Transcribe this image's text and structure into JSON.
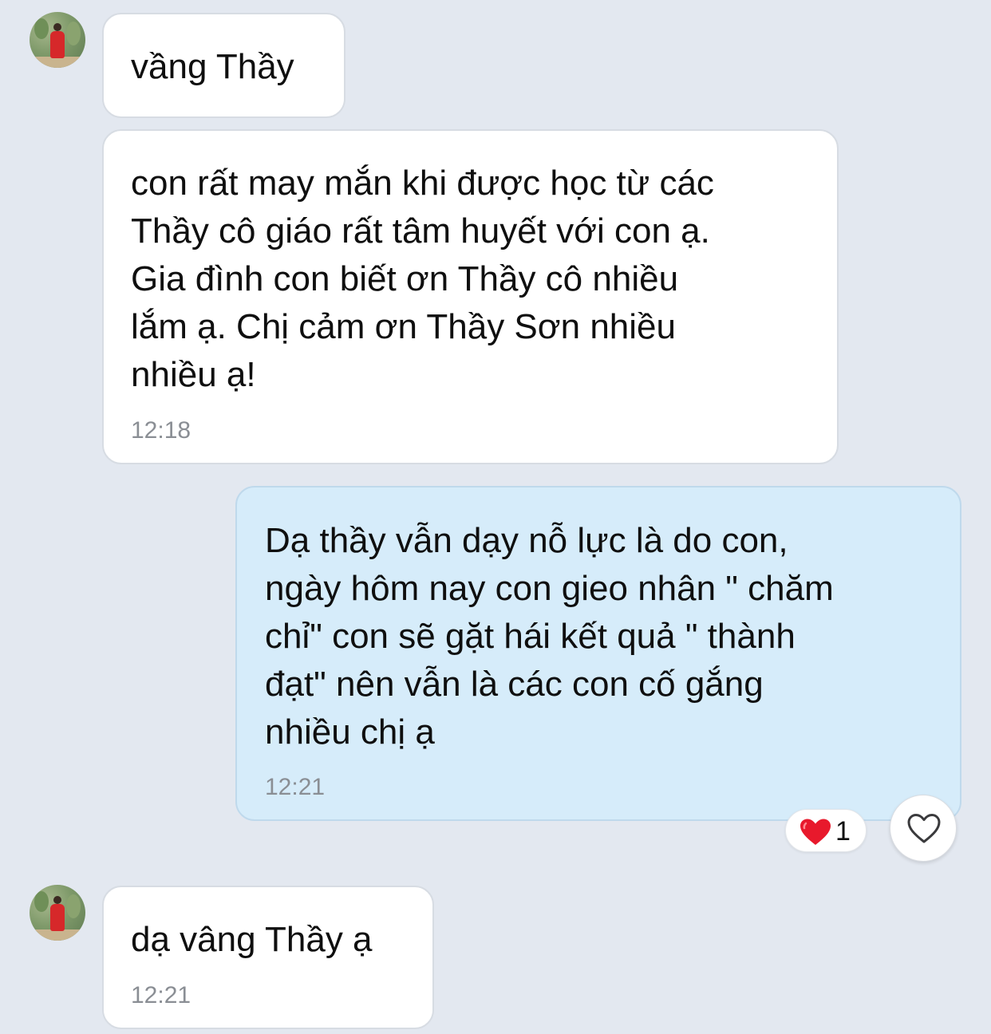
{
  "messages": [
    {
      "sender": "other",
      "text": "vầng Thầy",
      "time": ""
    },
    {
      "sender": "other",
      "text": "con rất may mắn khi được học từ các\nThầy cô giáo rất tâm huyết với con ạ.\nGia đình con biết ơn Thầy cô nhiều\nlắm ạ. Chị cảm ơn Thầy Sơn nhiều\nnhiều ạ!",
      "time": "12:18"
    },
    {
      "sender": "me",
      "text": "Dạ thầy vẫn dạy nỗ lực là do con,\nngày hôm nay con gieo nhân \" chăm\nchỉ\" con sẽ gặt hái kết quả \" thành\nđạt\" nên vẫn là các con cố gắng\nnhiều chị ạ",
      "time": "12:21",
      "reaction": {
        "icon": "red-heart-icon",
        "count": "1"
      }
    },
    {
      "sender": "other",
      "text": "dạ vâng Thầy ạ",
      "time": "12:21"
    }
  ],
  "like_button": {
    "icon": "heart-outline-icon"
  },
  "colors": {
    "background": "#E3E8F0",
    "incoming_bubble": "#FFFFFF",
    "outgoing_bubble": "#D6ECFA",
    "timestamp": "#8A8E94",
    "reaction_heart": "#E8192C"
  }
}
